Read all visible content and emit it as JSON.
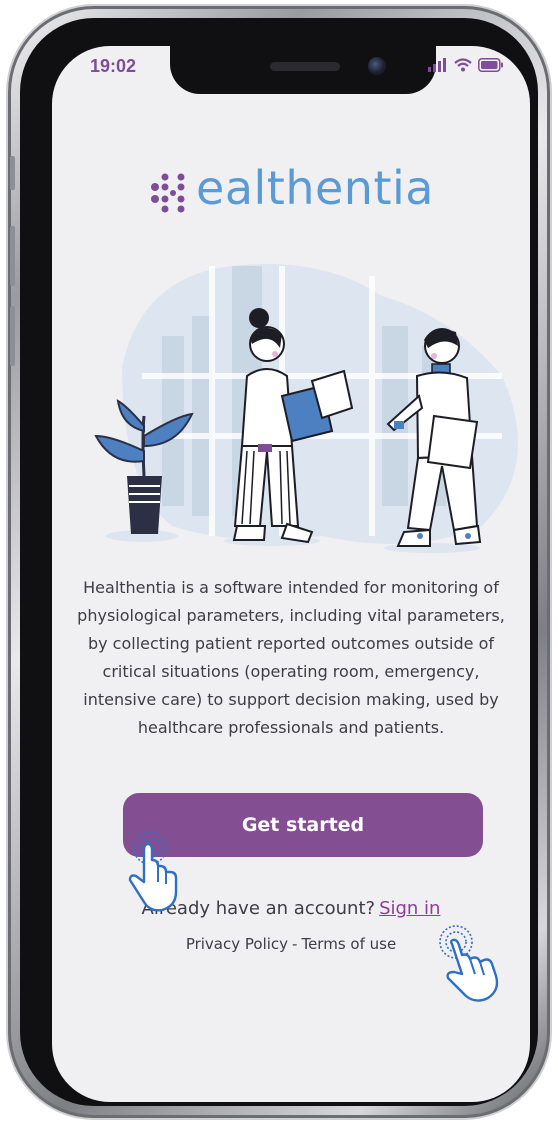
{
  "status_bar": {
    "time": "19:02"
  },
  "brand": {
    "name": "Healthentia",
    "logo_tail": "ealthentia",
    "color": "#5b9bd5",
    "dot_color": "#7e4e95"
  },
  "description": "Healthentia is a software intended for monitoring of physiological parameters, including vital parameters, by collecting patient reported outcomes outside of critical situations (operating room, emergency, intensive care) to support decision making, used by healthcare professionals and patients.",
  "buttons": {
    "get_started": "Get started"
  },
  "account": {
    "prompt": "Already have an account?",
    "sign_in": "Sign in"
  },
  "legal": {
    "privacy": "Privacy Policy",
    "separator": "-",
    "terms": "Terms of use"
  },
  "colors": {
    "primary_button": "#844f92",
    "link": "#8e3b97",
    "text": "#3d3d42",
    "screen_bg": "#f0f0f2",
    "tap_hint": "#2f6fc4"
  },
  "icons": {
    "signal": "signal-bars-icon",
    "wifi": "wifi-icon",
    "battery": "battery-icon",
    "tap_hint": "tap-hand-icon"
  }
}
